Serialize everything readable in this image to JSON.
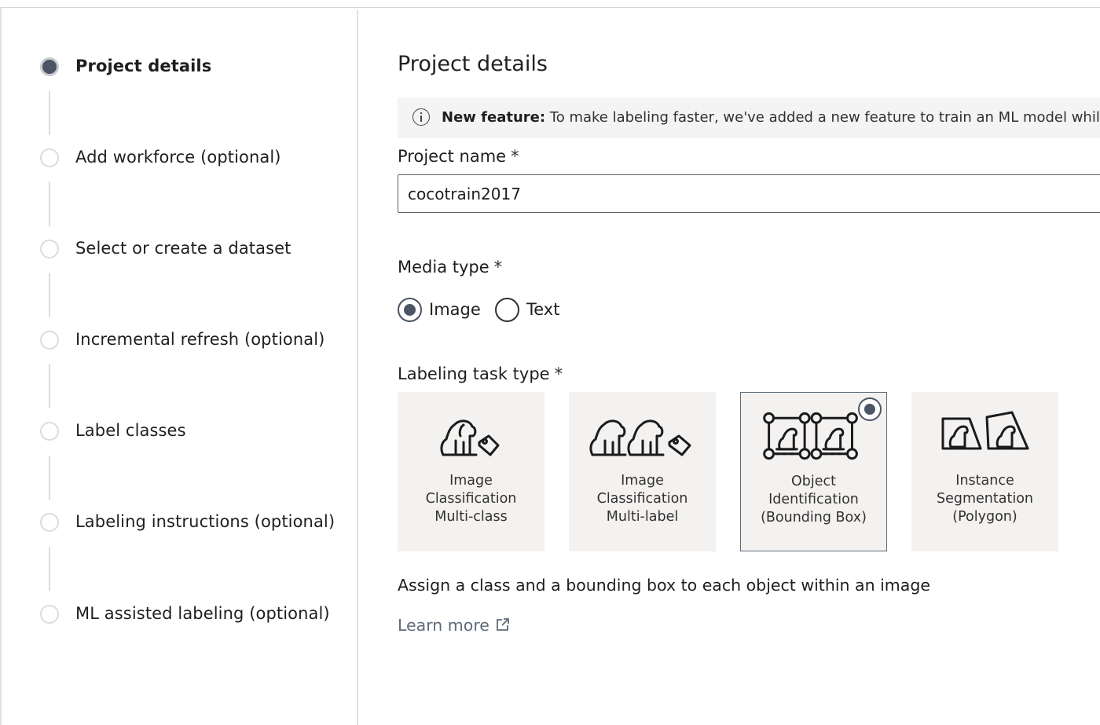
{
  "wizard": {
    "steps": [
      {
        "label": "Project details",
        "active": true
      },
      {
        "label": "Add workforce (optional)",
        "active": false
      },
      {
        "label": "Select or create a dataset",
        "active": false
      },
      {
        "label": "Incremental refresh (optional)",
        "active": false
      },
      {
        "label": "Label classes",
        "active": false
      },
      {
        "label": "Labeling instructions (optional)",
        "active": false
      },
      {
        "label": "ML assisted labeling (optional)",
        "active": false
      }
    ]
  },
  "main": {
    "title": "Project details",
    "banner": {
      "bold": "New feature:",
      "text": " To make labeling faster, we've added a new feature to train an ML model while you label"
    },
    "project_name": {
      "label": "Project name",
      "required_mark": "*",
      "value": "cocotrain2017"
    },
    "media_type": {
      "label": "Media type",
      "required_mark": "*",
      "options": [
        {
          "label": "Image",
          "checked": true
        },
        {
          "label": "Text",
          "checked": false
        }
      ]
    },
    "task_type": {
      "label": "Labeling task type",
      "required_mark": "*",
      "tiles": [
        {
          "lines": [
            "Image",
            "Classification",
            "Multi-class"
          ],
          "icon": "dog-tag-icon",
          "selected": false
        },
        {
          "lines": [
            "Image",
            "Classification",
            "Multi-label"
          ],
          "icon": "two-dogs-tag-icon",
          "selected": false
        },
        {
          "lines": [
            "Object",
            "Identification",
            "(Bounding Box)"
          ],
          "icon": "bounding-box-icon",
          "selected": true
        },
        {
          "lines": [
            "Instance",
            "Segmentation",
            "(Polygon)"
          ],
          "icon": "polygon-icon",
          "selected": false
        }
      ]
    },
    "description": "Assign a class and a bounding box to each object within an image",
    "learn_more": "Learn more"
  },
  "colors": {
    "accent": "#4b5563",
    "tile_bg": "#f3f2f1",
    "banner_bg": "#f4f4f4",
    "link": "#5f6b7a"
  }
}
